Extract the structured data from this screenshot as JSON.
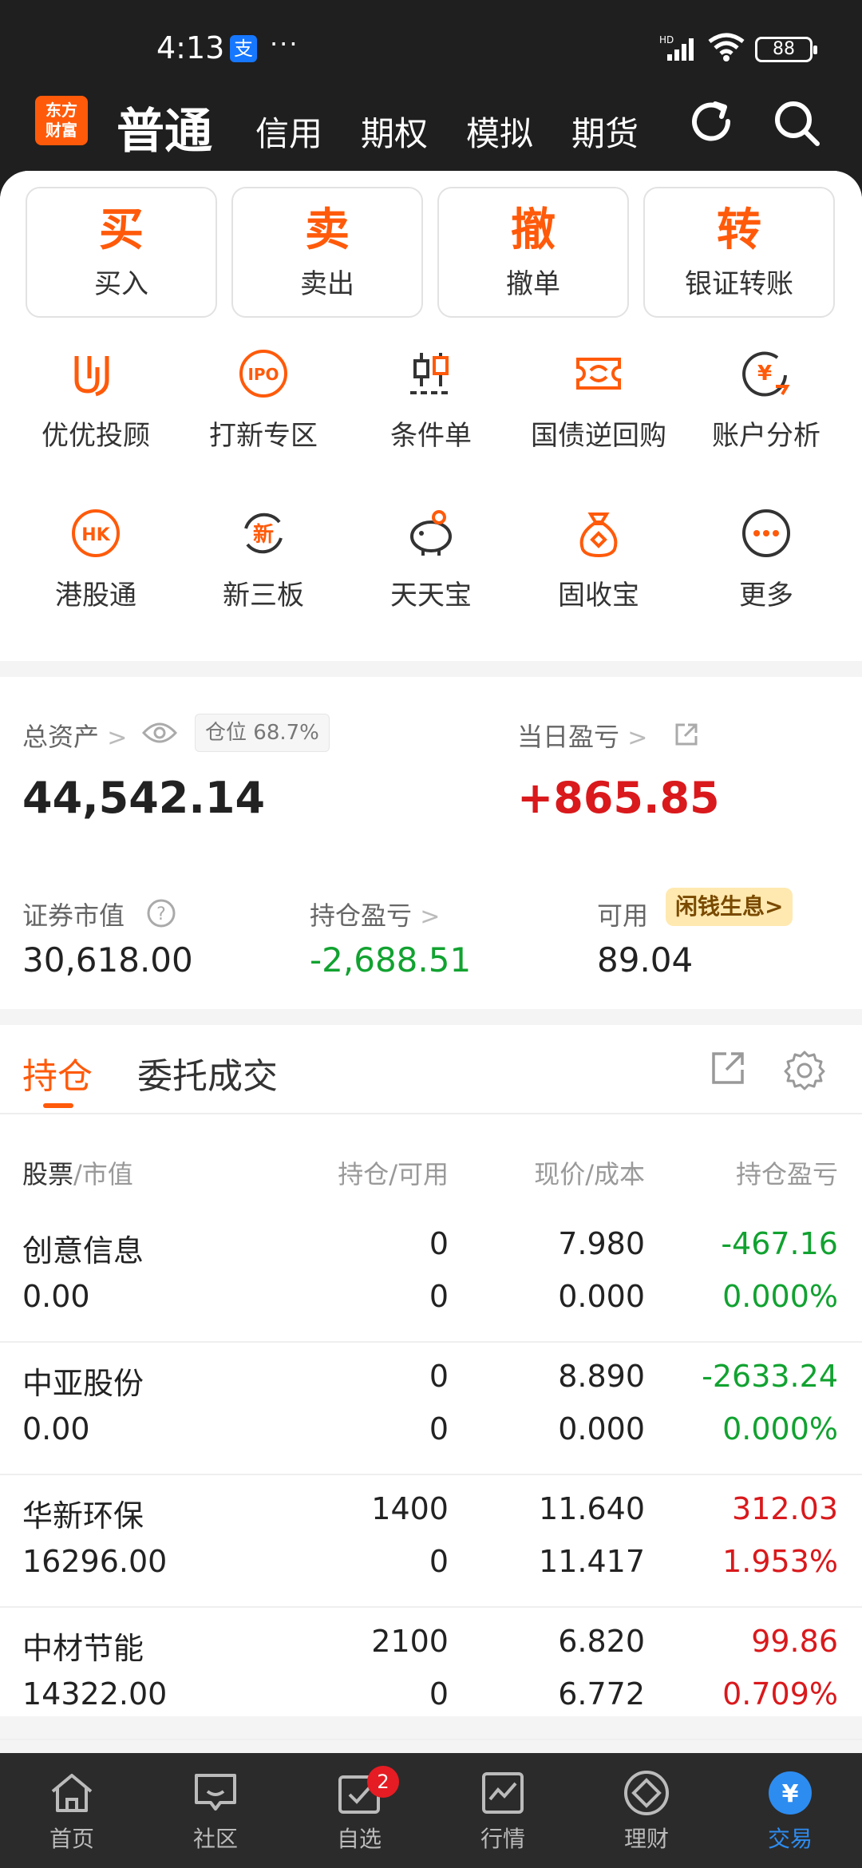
{
  "status_bar": {
    "time": "4:13",
    "alipay_glyph": "支",
    "more_dots": "···",
    "network": "HD",
    "battery": "88"
  },
  "header": {
    "logo_line1": "东方",
    "logo_line2": "财富",
    "tabs": [
      "普通",
      "信用",
      "期权",
      "模拟",
      "期货"
    ],
    "icons": [
      "refresh-icon",
      "search-icon"
    ]
  },
  "actions": [
    {
      "glyph": "买",
      "label": "买入"
    },
    {
      "glyph": "卖",
      "label": "卖出"
    },
    {
      "glyph": "撤",
      "label": "撤单"
    },
    {
      "glyph": "转",
      "label": "银证转账"
    }
  ],
  "tools": [
    {
      "label": "优优投顾",
      "icon": "advisor-icon"
    },
    {
      "label": "打新专区",
      "icon": "ipo-icon",
      "icon_text": "IPO"
    },
    {
      "label": "条件单",
      "icon": "candlestick-icon"
    },
    {
      "label": "国债逆回购",
      "icon": "repo-icon"
    },
    {
      "label": "账户分析",
      "icon": "yuan-analysis-icon",
      "icon_text": "¥"
    },
    {
      "label": "港股通",
      "icon": "hk-icon",
      "icon_text": "HK"
    },
    {
      "label": "新三板",
      "icon": "new-board-icon",
      "icon_text": "新"
    },
    {
      "label": "天天宝",
      "icon": "piggy-bank-icon"
    },
    {
      "label": "固收宝",
      "icon": "money-bag-icon"
    },
    {
      "label": "更多",
      "icon": "more-icon"
    }
  ],
  "assets": {
    "total_label": "总资产",
    "total_value": "44,542.14",
    "position_ratio_label": "仓位",
    "position_ratio_value": "68.7%",
    "daily_pl_label": "当日盈亏",
    "daily_pl_value": "+865.85",
    "market_value_label": "证券市值",
    "market_value": "30,618.00",
    "holding_pl_label": "持仓盈亏",
    "holding_pl_value": "-2,688.51",
    "available_label": "可用",
    "available_value": "89.04",
    "idle_money_label": "闲钱生息>"
  },
  "positions": {
    "tab_active": "持仓",
    "tab_other": "委托成交",
    "headers": {
      "stock_a": "股票",
      "stock_b": "/市值",
      "qty": "持仓/可用",
      "price": "现价/成本",
      "pl": "持仓盈亏"
    },
    "rows": [
      {
        "name": "创意信息",
        "value": "0.00",
        "hold": "0",
        "avail": "0",
        "price": "7.980",
        "cost": "0.000",
        "pl": "-467.16",
        "pl_pct": "0.000%"
      },
      {
        "name": "中亚股份",
        "value": "0.00",
        "hold": "0",
        "avail": "0",
        "price": "8.890",
        "cost": "0.000",
        "pl": "-2633.24",
        "pl_pct": "0.000%"
      },
      {
        "name": "华新环保",
        "value": "16296.00",
        "hold": "1400",
        "avail": "0",
        "price": "11.640",
        "cost": "11.417",
        "pl": "312.03",
        "pl_pct": "1.953%"
      },
      {
        "name": "中材节能",
        "value": "14322.00",
        "hold": "2100",
        "avail": "0",
        "price": "6.820",
        "cost": "6.772",
        "pl": "99.86",
        "pl_pct": "0.709%"
      }
    ]
  },
  "tabbar": [
    {
      "label": "首页",
      "icon": "home-icon"
    },
    {
      "label": "社区",
      "icon": "community-icon"
    },
    {
      "label": "自选",
      "icon": "watchlist-icon",
      "badge": "2"
    },
    {
      "label": "行情",
      "icon": "market-chart-icon"
    },
    {
      "label": "理财",
      "icon": "wealth-icon"
    },
    {
      "label": "交易",
      "icon": "trade-yuan-icon",
      "active": true
    }
  ],
  "colors": {
    "accent": "#ff5a0a",
    "gain": "#d9191c",
    "loss": "#11a230",
    "active_tab": "#2d8cf0"
  }
}
